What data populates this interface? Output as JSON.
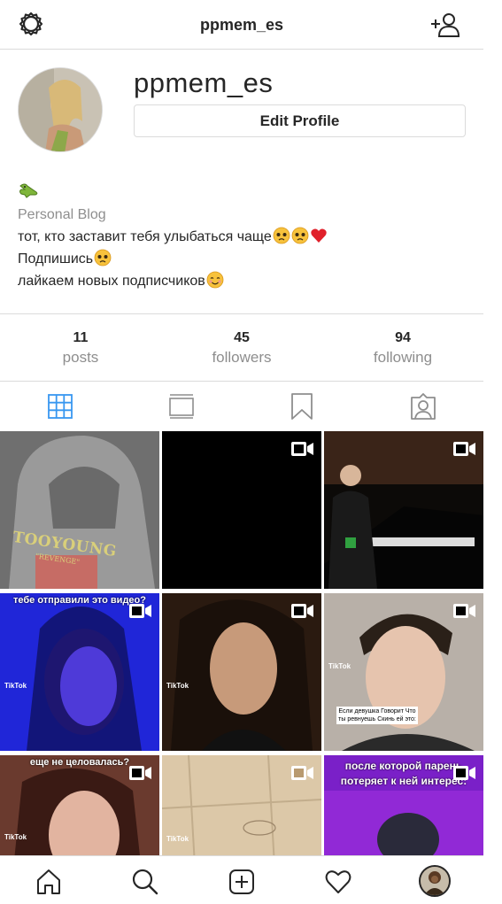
{
  "header": {
    "title": "ppmem_es",
    "settings_icon": "gear-icon",
    "add_user_icon": "add-user-icon"
  },
  "profile": {
    "username": "ppmem_es",
    "edit_button": "Edit Profile",
    "bio": {
      "emoji_line": "🐊",
      "category": "Personal Blog",
      "line1": "тот, кто заставит тебя улыбаться чаще",
      "line1_emojis": [
        "pleading-face",
        "pleading-face",
        "red-heart"
      ],
      "line2": "Подпишись",
      "line2_emojis": [
        "pleading-face"
      ],
      "line3": "лайкаем новых подписчиков",
      "line3_emojis": [
        "smiling-face"
      ]
    }
  },
  "stats": [
    {
      "value": "11",
      "label": "posts"
    },
    {
      "value": "45",
      "label": "followers"
    },
    {
      "value": "94",
      "label": "following"
    }
  ],
  "tabs": [
    "grid-icon",
    "feed-icon",
    "saved-icon",
    "tagged-icon"
  ],
  "active_tab": "grid-icon",
  "posts": [
    {
      "type": "photo",
      "text": "TOOYOUNG",
      "subtext": "\"REVENGE\""
    },
    {
      "type": "video",
      "text": ""
    },
    {
      "type": "video",
      "text": ""
    },
    {
      "type": "video",
      "text": "тебе отправили это видео?",
      "watermark": "TikTok"
    },
    {
      "type": "video",
      "text": "",
      "watermark": "TikTok"
    },
    {
      "type": "video",
      "text": "",
      "watermark": "TikTok",
      "subtitle": "Если девушка Говорит Что ты ревнуешь Скинь ей это:"
    },
    {
      "type": "video",
      "text": "еще не целовалась?",
      "watermark": "TikTok"
    },
    {
      "type": "video",
      "text": "",
      "watermark": "TikTok"
    },
    {
      "type": "video",
      "text": "после которой парень потеряет к ней интерес:",
      "watermark": ""
    }
  ],
  "bottom_nav": [
    "home-icon",
    "search-icon",
    "new-post-icon",
    "activity-heart-icon",
    "profile-avatar"
  ],
  "colors": {
    "accent": "#3897f0",
    "text": "#262626",
    "muted": "#8e8e8e",
    "border": "#dbdbdb"
  }
}
